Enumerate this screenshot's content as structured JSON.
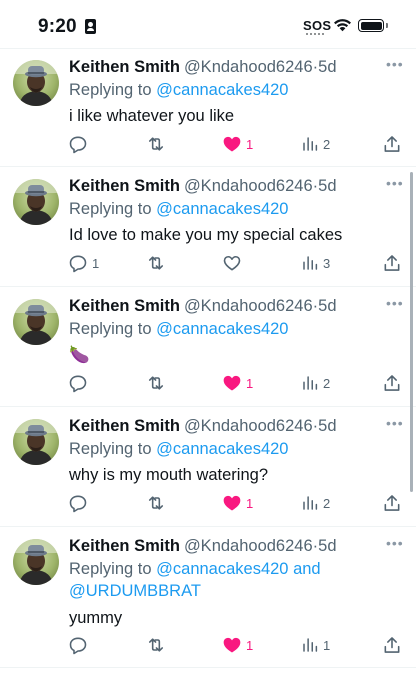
{
  "status_bar": {
    "time": "9:20",
    "sos": "SOS",
    "contact_icon": "person-card-icon",
    "wifi_icon": "wifi-icon",
    "battery_icon": "battery-icon"
  },
  "colors": {
    "like": "#f91880",
    "link": "#1d9bf0",
    "muted": "#536471"
  },
  "replies": [
    {
      "name": "Keithen Smith",
      "handle": "@Kndahood6246",
      "dot": "·",
      "time": "5d",
      "replying_prefix": "Replying to ",
      "replying_to": "@cannacakes420",
      "replying_more": "",
      "text": "i like whatever you like",
      "reply_count": "",
      "retweet_count": "",
      "like_count": "1",
      "liked": true,
      "view_count": "2"
    },
    {
      "name": "Keithen Smith",
      "handle": "@Kndahood6246",
      "dot": "·",
      "time": "5d",
      "replying_prefix": "Replying to ",
      "replying_to": "@cannacakes420",
      "replying_more": "",
      "text": "Id love to make you my special cakes",
      "reply_count": "1",
      "retweet_count": "",
      "like_count": "",
      "liked": false,
      "view_count": "3"
    },
    {
      "name": "Keithen Smith",
      "handle": "@Kndahood6246",
      "dot": "·",
      "time": "5d",
      "replying_prefix": "Replying to ",
      "replying_to": "@cannacakes420",
      "replying_more": "",
      "text": "🍆",
      "reply_count": "",
      "retweet_count": "",
      "like_count": "1",
      "liked": true,
      "view_count": "2"
    },
    {
      "name": "Keithen Smith",
      "handle": "@Kndahood6246",
      "dot": "·",
      "time": "5d",
      "replying_prefix": "Replying to ",
      "replying_to": "@cannacakes420",
      "replying_more": "",
      "text": "why is my mouth watering?",
      "reply_count": "",
      "retweet_count": "",
      "like_count": "1",
      "liked": true,
      "view_count": "2"
    },
    {
      "name": "Keithen Smith",
      "handle": "@Kndahood6246",
      "dot": "·",
      "time": "5d",
      "replying_prefix": "Replying to ",
      "replying_to": "@cannacakes420",
      "replying_joiner": " and",
      "replying_more": "@URDUMBBRAT",
      "text": "yummy",
      "reply_count": "",
      "retweet_count": "",
      "like_count": "1",
      "liked": true,
      "view_count": "1"
    }
  ]
}
